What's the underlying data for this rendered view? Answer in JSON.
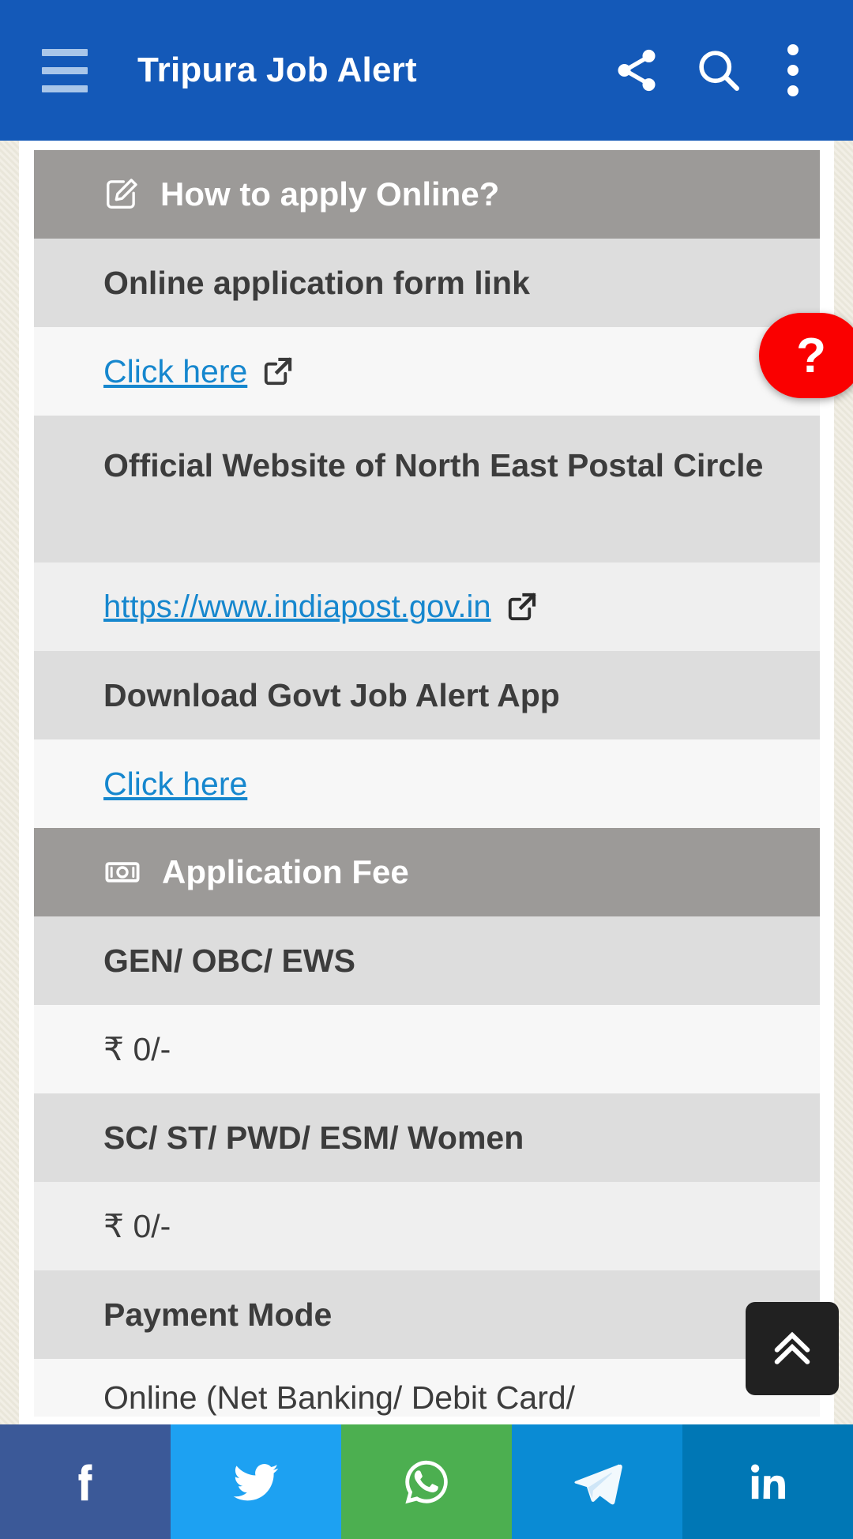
{
  "app_bar": {
    "title": "Tripura Job Alert",
    "menu_icon": "hamburger-menu-icon",
    "share_icon": "share-icon",
    "search_icon": "search-icon",
    "overflow_icon": "more-vertical-icon",
    "background_color": "#1459b8"
  },
  "floating": {
    "help_label": "?",
    "help_color": "#fa0000",
    "scroll_top_icon": "double-chevron-up-icon",
    "scroll_top_color": "#212121"
  },
  "content": {
    "rows": [
      {
        "type": "section",
        "icon": "edit-square-icon",
        "label": "How to apply Online?"
      },
      {
        "type": "label",
        "label": "Online application form link"
      },
      {
        "type": "link",
        "label": "Click here",
        "external": true
      },
      {
        "type": "label-wrap",
        "label": "Official Website of North East Postal Circle"
      },
      {
        "type": "link-alt",
        "label": "https://www.indiapost.gov.in",
        "external": true
      },
      {
        "type": "label",
        "label": "Download Govt Job Alert App"
      },
      {
        "type": "link",
        "label": "Click here",
        "external": false
      },
      {
        "type": "section",
        "icon": "banknote-icon",
        "label": "Application Fee"
      },
      {
        "type": "label",
        "label": "GEN/ OBC/ EWS"
      },
      {
        "type": "value",
        "label": "₹ 0/-"
      },
      {
        "type": "label",
        "label": "SC/ ST/ PWD/ ESM/ Women"
      },
      {
        "type": "value-alt",
        "label": "₹ 0/-"
      },
      {
        "type": "label",
        "label": "Payment Mode"
      },
      {
        "type": "value-clipped",
        "label": "Online (Net Banking/ Debit Card/"
      }
    ]
  },
  "social_bar": {
    "items": [
      {
        "name": "facebook",
        "icon": "facebook-icon",
        "color": "#3b5998"
      },
      {
        "name": "twitter",
        "icon": "twitter-bird-icon",
        "color": "#1da1f2"
      },
      {
        "name": "whatsapp",
        "icon": "whatsapp-icon",
        "color": "#4caf50"
      },
      {
        "name": "telegram",
        "icon": "telegram-plane-icon",
        "color": "#0a8bd4"
      },
      {
        "name": "linkedin",
        "icon": "linkedin-icon",
        "color": "#0077b5"
      }
    ]
  }
}
